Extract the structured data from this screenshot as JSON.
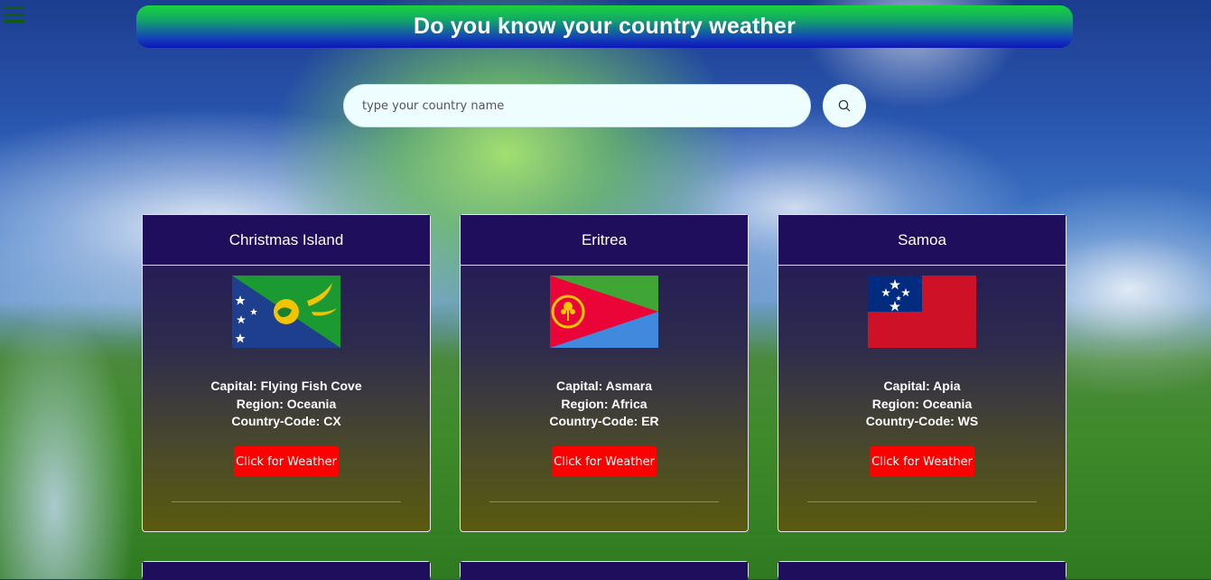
{
  "header": {
    "title": "Do you know your country weather"
  },
  "menu": {
    "icon": "hamburger-icon"
  },
  "search": {
    "placeholder": "type your country name",
    "value": "",
    "icon": "search-icon"
  },
  "cards": [
    {
      "name": "Christmas Island",
      "capital": "Capital: Flying Fish Cove",
      "region": "Region: Oceania",
      "code": "Country-Code: CX",
      "button": "Click for Weather"
    },
    {
      "name": "Eritrea",
      "capital": "Capital: Asmara",
      "region": "Region: Africa",
      "code": "Country-Code: ER",
      "button": "Click for Weather"
    },
    {
      "name": "Samoa",
      "capital": "Capital: Apia",
      "region": "Region: Oceania",
      "code": "Country-Code: WS",
      "button": "Click for Weather"
    }
  ],
  "colors": {
    "header_top": "#18d43a",
    "header_bottom": "#0e15b8",
    "card_header": "#1e0e5c",
    "button": "#ff0000",
    "search_bg": "#eefefe"
  }
}
